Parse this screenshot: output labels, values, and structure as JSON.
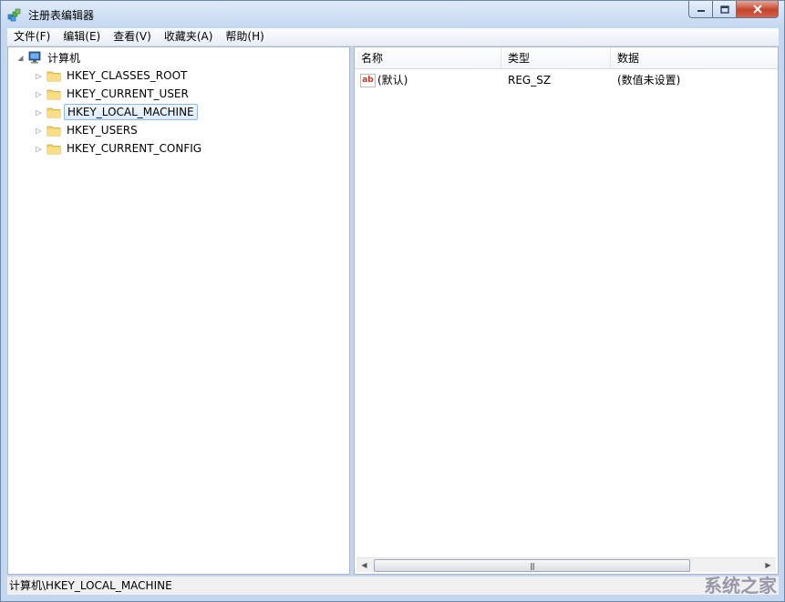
{
  "window": {
    "title": "注册表编辑器"
  },
  "menu": [
    "文件(F)",
    "编辑(E)",
    "查看(V)",
    "收藏夹(A)",
    "帮助(H)"
  ],
  "tree": {
    "root": {
      "label": "计算机",
      "icon": "computer-icon"
    },
    "keys": [
      {
        "label": "HKEY_CLASSES_ROOT",
        "selected": false
      },
      {
        "label": "HKEY_CURRENT_USER",
        "selected": false
      },
      {
        "label": "HKEY_LOCAL_MACHINE",
        "selected": true
      },
      {
        "label": "HKEY_USERS",
        "selected": false
      },
      {
        "label": "HKEY_CURRENT_CONFIG",
        "selected": false
      }
    ]
  },
  "values_list": {
    "columns": [
      "名称",
      "类型",
      "数据"
    ],
    "rows": [
      {
        "name": "(默认)",
        "type": "REG_SZ",
        "data": "(数值未设置)",
        "icon": "string-value-icon",
        "icon_text": "ab"
      }
    ]
  },
  "statusbar": {
    "path": "计算机\\HKEY_LOCAL_MACHINE"
  },
  "watermark": {
    "text": "系统之家"
  },
  "colors": {
    "selection_border": "#8fb8e4",
    "close_button": "#c4432c",
    "frame": "#c5d7ee"
  }
}
